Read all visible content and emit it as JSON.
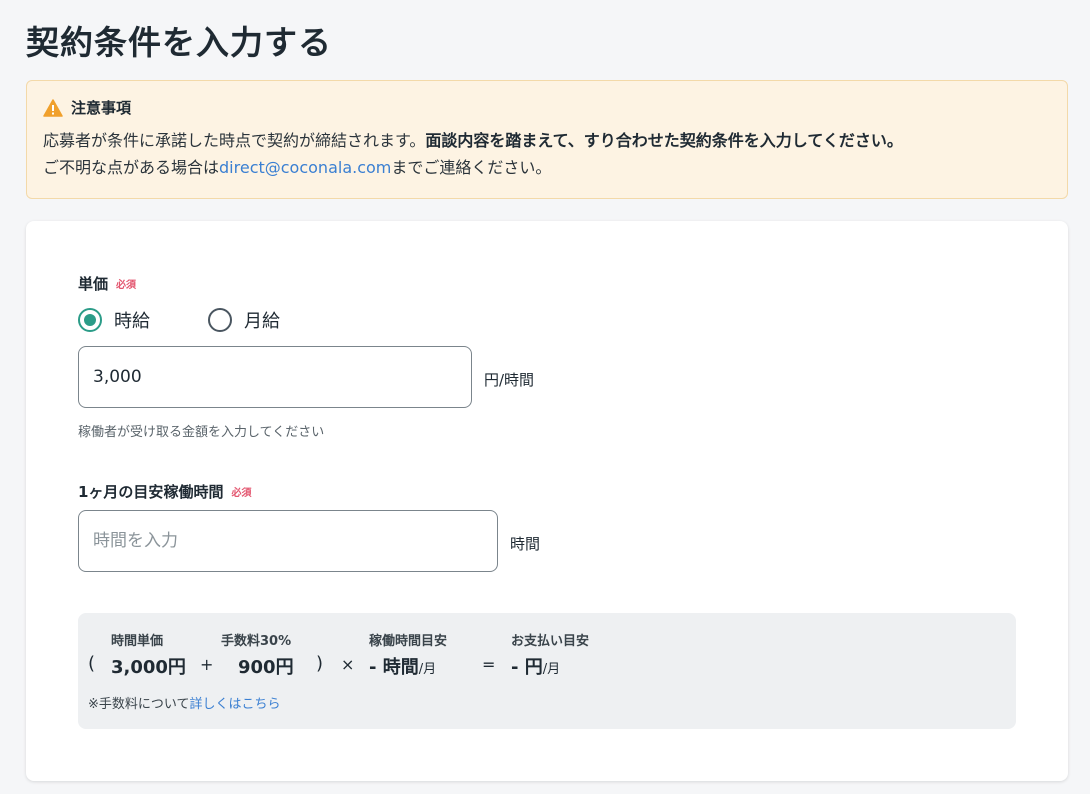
{
  "page": {
    "title": "契約条件を入力する"
  },
  "notice": {
    "heading": "注意事項",
    "line1_plain": "応募者が条件に承諾した時点で契約が締結されます。",
    "line1_bold": "面談内容を踏まえて、すり合わせた契約条件を入力してください。",
    "line2_prefix": "ご不明な点がある場合は",
    "email": "direct@coconala.com",
    "line2_suffix": "までご連絡ください。"
  },
  "unit_price": {
    "label": "単価",
    "required": "必須",
    "options": [
      {
        "label": "時給",
        "checked": true
      },
      {
        "label": "月給",
        "checked": false
      }
    ],
    "value": "3,000",
    "unit": "円/時間",
    "hint": "稼働者が受け取る金額を入力してください"
  },
  "monthly_hours": {
    "label": "1ヶ月の目安稼働時間",
    "required": "必須",
    "placeholder": "時間を入力",
    "value": "",
    "unit": "時間"
  },
  "calculation": {
    "headers": [
      "時間単価",
      "手数料30%",
      "稼働時間目安",
      "お支払い目安"
    ],
    "open_paren": "(",
    "hourly": "3,000円",
    "plus": "+",
    "fee": "900円",
    "close_paren": ")",
    "times": "×",
    "hours_value": "- 時間",
    "hours_suffix": "/月",
    "equals": "=",
    "payment_value": "- 円",
    "payment_suffix": "/月",
    "note_prefix": "※手数料について",
    "note_link": "詳しくはこちら"
  },
  "colors": {
    "accent": "#2b9c88",
    "required": "#e3566f",
    "link": "#3a7fd2",
    "notice_bg": "#fdf3e3",
    "warning_icon": "#f0a02c"
  }
}
